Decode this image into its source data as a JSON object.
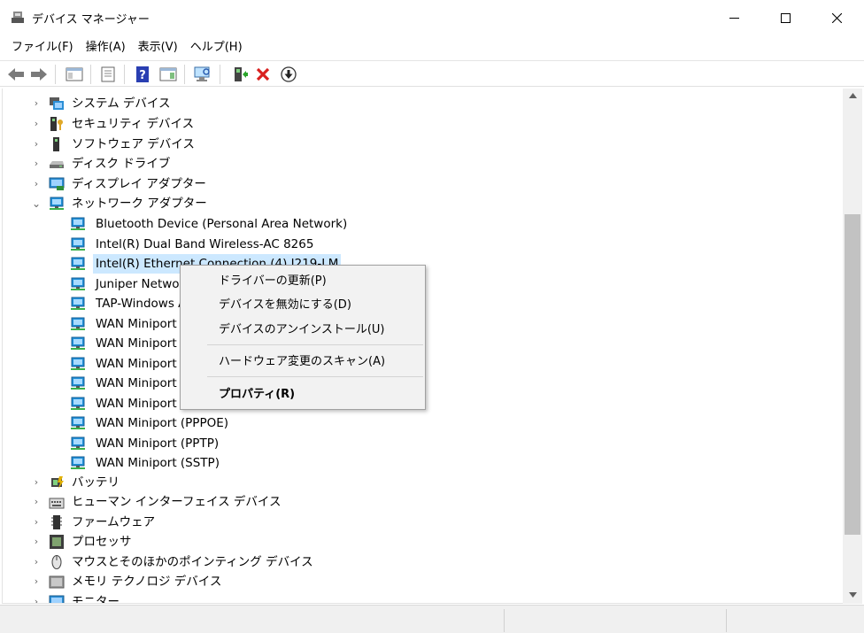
{
  "window": {
    "title": "デバイス マネージャー",
    "minimize_glyph": "—",
    "maximize_glyph": "☐",
    "close_glyph": "✕"
  },
  "menu": [
    "ファイル(F)",
    "操作(A)",
    "表示(V)",
    "ヘルプ(H)"
  ],
  "toolbar": {
    "buttons": [
      "back-icon",
      "forward-icon",
      "show-hide-console-tree-icon",
      "properties-icon",
      "help-icon",
      "action-pane-icon",
      "scan-hardware-icon",
      "update-driver-icon",
      "uninstall-icon",
      "disable-device-icon"
    ]
  },
  "tree": {
    "categories_top": [
      {
        "label": "システム デバイス",
        "icon": "system-devices-icon"
      },
      {
        "label": "セキュリティ デバイス",
        "icon": "security-devices-icon"
      },
      {
        "label": "ソフトウェア デバイス",
        "icon": "software-devices-icon"
      },
      {
        "label": "ディスク ドライブ",
        "icon": "disk-drive-icon"
      },
      {
        "label": "ディスプレイ アダプター",
        "icon": "display-adapter-icon"
      }
    ],
    "expanded": {
      "label": "ネットワーク アダプター",
      "icon": "network-adapter-icon"
    },
    "network_children": [
      "Bluetooth Device (Personal Area Network)",
      "Intel(R) Dual Band Wireless-AC 8265",
      "Intel(R) Ethernet Connection (4) I219-LM",
      "Juniper Networ",
      "TAP-Windows A",
      "WAN Miniport",
      "WAN Miniport",
      "WAN Miniport",
      "WAN Miniport",
      "WAN Miniport",
      "WAN Miniport (PPPOE)",
      "WAN Miniport (PPTP)",
      "WAN Miniport (SSTP)"
    ],
    "categories_bottom": [
      {
        "label": "バッテリ",
        "icon": "battery-icon"
      },
      {
        "label": "ヒューマン インターフェイス デバイス",
        "icon": "hid-icon"
      },
      {
        "label": "ファームウェア",
        "icon": "firmware-icon"
      },
      {
        "label": "プロセッサ",
        "icon": "processor-icon"
      },
      {
        "label": "マウスとそのほかのポインティング デバイス",
        "icon": "mouse-icon"
      },
      {
        "label": "メモリ テクノロジ デバイス",
        "icon": "memory-tech-icon"
      },
      {
        "label": "モニター",
        "icon": "monitor-icon"
      }
    ]
  },
  "context_menu": {
    "items": [
      "ドライバーの更新(P)",
      "デバイスを無効にする(D)",
      "デバイスのアンインストール(U)",
      "ハードウェア変更のスキャン(A)",
      "プロパティ(R)"
    ]
  },
  "colors": {
    "selection": "#cce8ff",
    "network_icon_blue": "#1f8fd8",
    "network_icon_green": "#3bb04a",
    "uninstall_red": "#d9201f"
  }
}
